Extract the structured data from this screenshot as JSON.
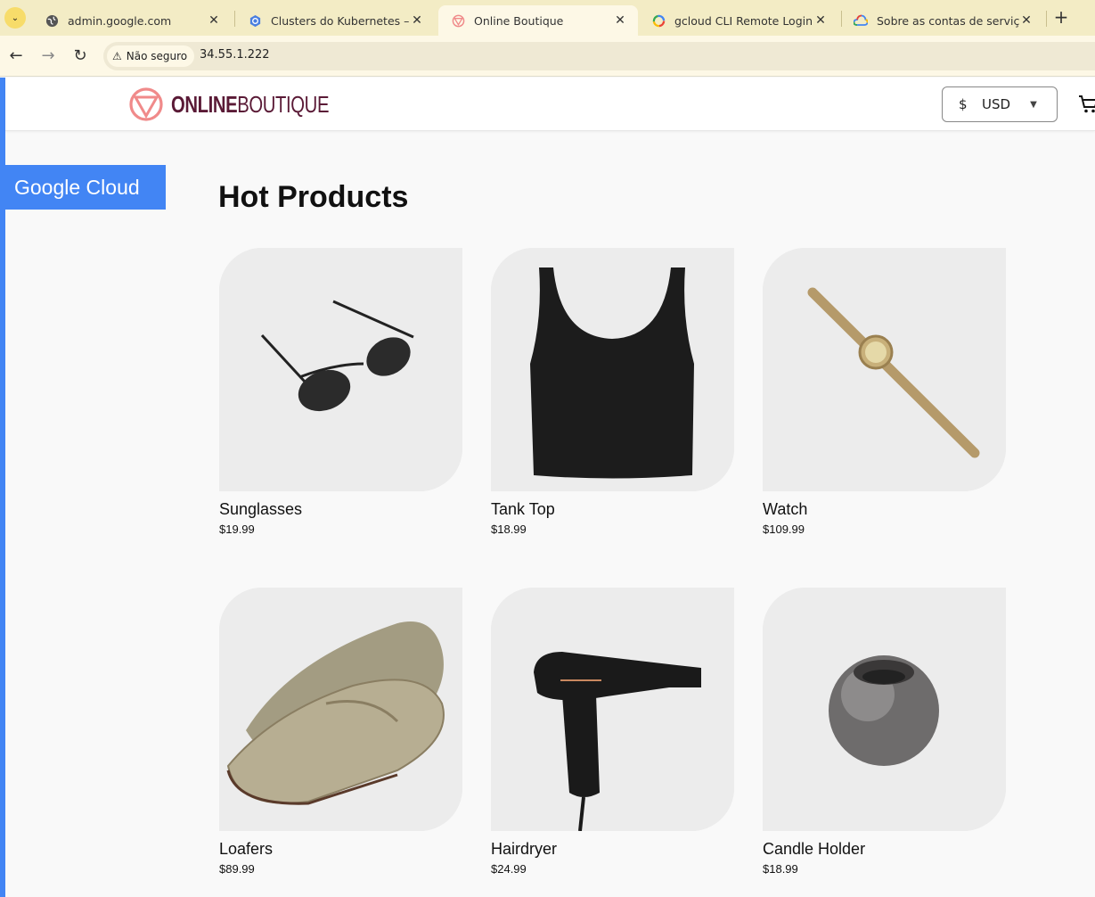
{
  "tabs": [
    {
      "title": "admin.google.com",
      "icon": "globe-icon",
      "active": false
    },
    {
      "title": "Clusters do Kubernetes – Kub",
      "icon": "kubernetes-icon",
      "active": false
    },
    {
      "title": "Online Boutique",
      "icon": "boutique-icon",
      "active": true
    },
    {
      "title": "gcloud CLI Remote Login",
      "icon": "google-icon",
      "active": false
    },
    {
      "title": "Sobre as contas de serviço no",
      "icon": "google-cloud-icon",
      "active": false
    }
  ],
  "toolbar": {
    "security_label": "Não seguro",
    "url": "34.55.1.222"
  },
  "header": {
    "logo_bold": "ONLINE",
    "logo_thin": "BOUTIQUE",
    "currency_symbol": "$",
    "currency_code": "USD"
  },
  "badge": "Google Cloud",
  "section_title": "Hot Products",
  "products": [
    {
      "name": "Sunglasses",
      "price": "$19.99"
    },
    {
      "name": "Tank Top",
      "price": "$18.99"
    },
    {
      "name": "Watch",
      "price": "$109.99"
    },
    {
      "name": "Loafers",
      "price": "$89.99"
    },
    {
      "name": "Hairdryer",
      "price": "$24.99"
    },
    {
      "name": "Candle Holder",
      "price": "$18.99"
    }
  ],
  "colors": {
    "brand": "#5a1a36",
    "logo_accent": "#f08a8a",
    "google_blue": "#4285f4"
  }
}
